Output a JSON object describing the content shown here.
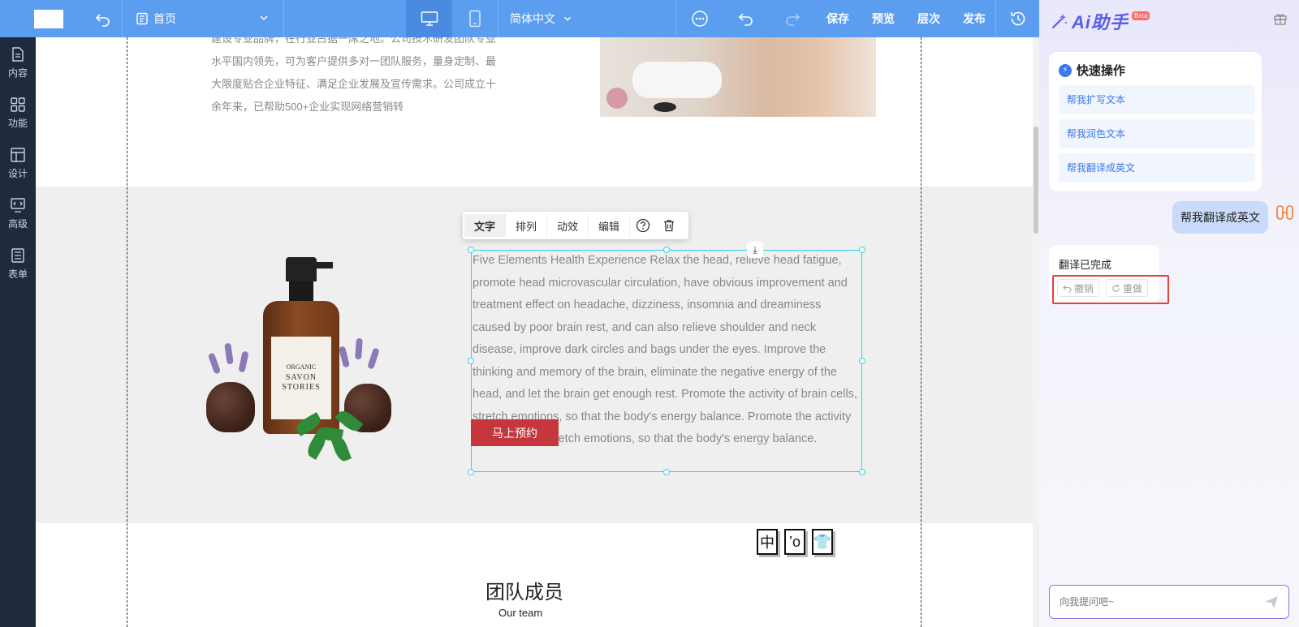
{
  "toolbar": {
    "page_name": "首页",
    "language": "简体中文",
    "save": "保存",
    "preview": "预览",
    "layers": "层次",
    "publish": "发布"
  },
  "sidebar": {
    "items": [
      {
        "label": "内容",
        "icon": "file-icon"
      },
      {
        "label": "功能",
        "icon": "grid-icon"
      },
      {
        "label": "设计",
        "icon": "layout-icon"
      },
      {
        "label": "高级",
        "icon": "monitor-code-icon"
      },
      {
        "label": "表单",
        "icon": "form-icon"
      }
    ]
  },
  "canvas": {
    "intro_text": "建设专业品牌，在行业占据一席之地。公司技术研发团队专业水平国内领先，可为客户提供多对一团队服务，量身定制、最大限度贴合企业特征、满足企业发展及宣传需求。公司成立十余年来，已帮助500+企业实现网络营销转",
    "bottle_label_top": "ORGANIC",
    "bottle_label_brand": "SAVON STORIES",
    "floating_toolbar": {
      "text": "文字",
      "arrange": "排列",
      "animation": "动效",
      "edit": "编辑"
    },
    "translated_text": "Five Elements Health Experience Relax the head, relieve head fatigue, promote head microvascular circulation, have obvious improvement and treatment effect on headache, dizziness, insomnia and dreaminess caused by poor brain rest, and can also relieve shoulder and neck disease, improve dark circles and bags under the eyes. Improve the thinking and memory of the brain, eliminate the negative energy of the head, and let the brain get enough rest. Promote the activity of brain cells, stretch emotions, so that the body's energy balance. Promote the activity of brain cells, stretch emotions, so that the body's energy balance.",
    "book_button": "马上预约",
    "lang_icons": [
      "中",
      "’o",
      "👕"
    ],
    "team_title": "团队成员",
    "team_subtitle": "Our team"
  },
  "ai_panel": {
    "logo": "Ai助手",
    "beta": "Beta",
    "quick_title": "快速操作",
    "quick_actions": [
      "帮我扩写文本",
      "帮我润色文本",
      "帮我翻译成英文"
    ],
    "user_message": "帮我翻译成英文",
    "bot_message": "翻译已完成",
    "undo": "撤销",
    "redo": "重做",
    "input_placeholder": "向我提问吧~"
  }
}
